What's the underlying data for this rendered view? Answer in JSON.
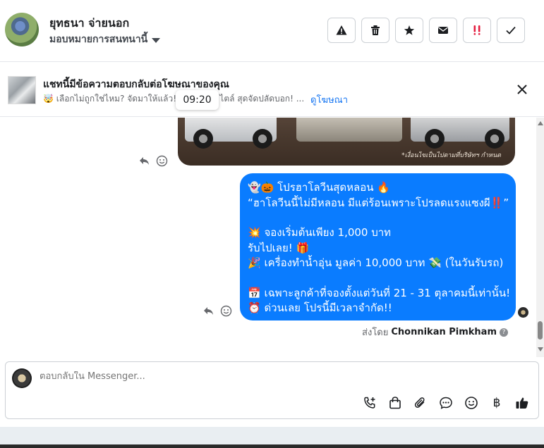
{
  "header": {
    "contact_name": "ยุทธนา จ่ายนอก",
    "assign_label": "มอบหมายการสนทนานี้",
    "actions": [
      {
        "name": "report-button",
        "icon": "warning-icon"
      },
      {
        "name": "delete-button",
        "icon": "trash-icon"
      },
      {
        "name": "star-button",
        "icon": "star-icon"
      },
      {
        "name": "mark-unread-button",
        "icon": "envelope-icon"
      },
      {
        "name": "follow-up-button",
        "icon": "double-exclaim-icon"
      },
      {
        "name": "mark-done-button",
        "icon": "check-icon"
      }
    ]
  },
  "ad_banner": {
    "title": "แชทนี้มีข้อความตอบกลับต่อโฆษณาของคุณ",
    "subtitle": "🤯 เลือกไม่ถูกใช่ไหม? จัดมาให้แล้ว! C",
    "subtitle_tail": "ไตล์ สุดจัดปลัดบอก! ...",
    "link_label": "ดูโฆษณา",
    "tooltip_time": "09:20"
  },
  "conversation": {
    "image_caption": "*เงื่อนไขเป็นไปตามที่บริษัทฯ กำหนด",
    "message_lines": [
      "👻🎃 โปรฮาโลวีนสุดหลอน 🔥",
      "“ฮาโลวีนนี้ไม่มีหลอน มีแต่ร้อนเพราะโปรลดแรงแซงผี‼️”",
      "",
      "💥 จองเริ่มต้นเพียง 1,000 บาท",
      "รับไปเลย! 🎁",
      "🎉 เครื่องทำน้ำอุ่น มูลค่า 10,000 บาท 💸 (ในวันรับรถ)",
      "",
      "📅 เฉพาะลูกค้าที่จองตั้งแต่วันที่ 21 - 31 ตุลาคมนี้เท่านั้น!",
      "⏰ ด่วนเลย โปรนี้มีเวลาจำกัด!!"
    ],
    "sent_by_prefix": "ส่งโดย",
    "sent_by_name": "Chonnikan Pimkham",
    "sent_by_help": "?"
  },
  "composer": {
    "placeholder": "ตอบกลับใน Messenger...",
    "currency_symbol": "฿",
    "tools": [
      "call-add-icon",
      "shopping-bag-icon",
      "paperclip-icon",
      "chat-bubble-icon",
      "emoji-icon",
      "baht-icon",
      "thumbs-up-icon"
    ]
  },
  "colors": {
    "bubble": "#0a7cff",
    "link": "#1877f2",
    "follow_up": "#e41e3f"
  }
}
